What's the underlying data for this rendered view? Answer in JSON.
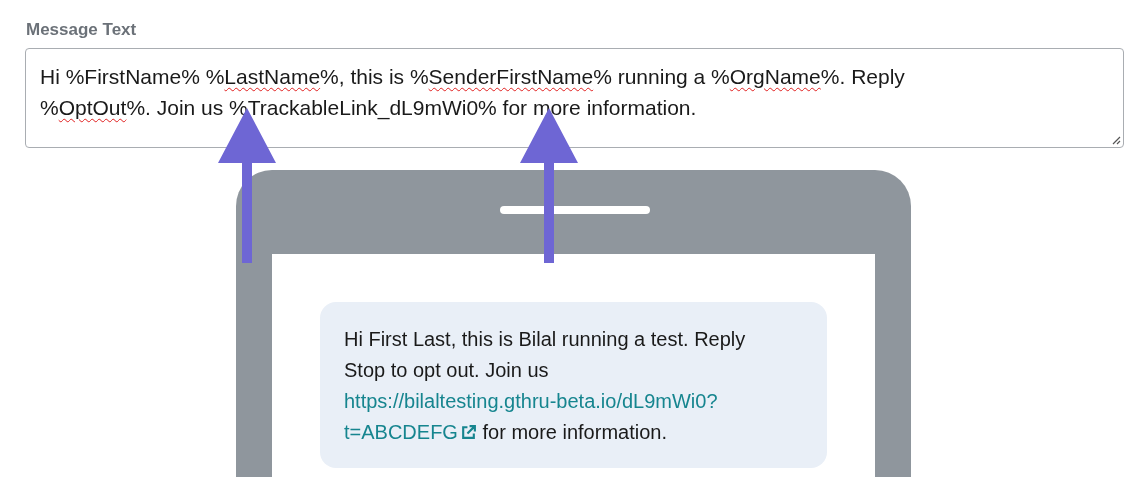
{
  "field": {
    "label": "Message Text",
    "lines": [
      [
        {
          "text": "Hi %FirstName% %",
          "misspelled": false
        },
        {
          "text": "LastName",
          "misspelled": true
        },
        {
          "text": "%, this is %",
          "misspelled": false
        },
        {
          "text": "SenderFirstName",
          "misspelled": true
        },
        {
          "text": "% running a %",
          "misspelled": false
        },
        {
          "text": "OrgName",
          "misspelled": true
        },
        {
          "text": "%. Reply",
          "misspelled": false
        }
      ],
      [
        {
          "text": "%",
          "misspelled": false
        },
        {
          "text": "OptOut",
          "misspelled": true
        },
        {
          "text": "%. Join us %TrackableLink_dL9mWi0% for more information.",
          "misspelled": false
        }
      ]
    ]
  },
  "preview": {
    "message": {
      "before": "Hi First Last, this is Bilal running a test. Reply Stop to opt out. Join us",
      "link_lines": [
        "https://bilaltesting.gthru-beta.io/dL9mWi0?",
        "t=ABCDEFG"
      ],
      "after": "for more information."
    }
  }
}
